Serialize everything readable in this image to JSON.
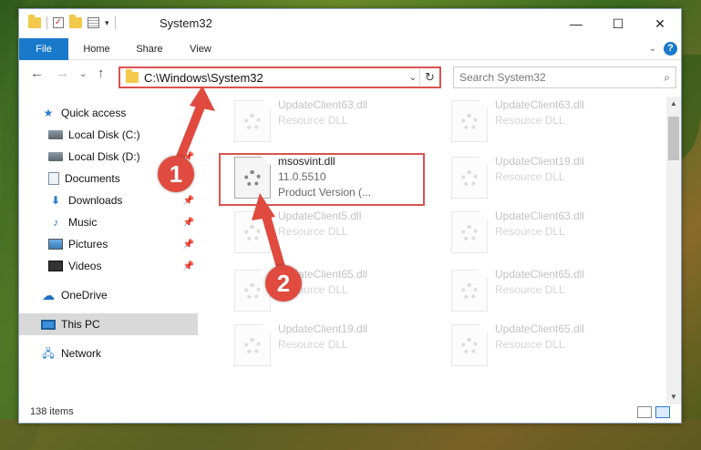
{
  "window": {
    "title": "System32",
    "minimize_icon": "minimize-icon",
    "maximize_icon": "maximize-icon",
    "close_icon": "close-icon"
  },
  "ribbon": {
    "tabs": [
      "File",
      "Home",
      "Share",
      "View"
    ],
    "accent": "#1979ca",
    "help": "?"
  },
  "nav": {
    "address": "C:\\Windows\\System32",
    "search_placeholder": "Search System32"
  },
  "sidebar": {
    "items": [
      {
        "label": "Quick access",
        "icon": "star-icon"
      },
      {
        "label": "Local Disk (C:)",
        "icon": "drive-icon"
      },
      {
        "label": "Local Disk (D:)",
        "icon": "drive-icon"
      },
      {
        "label": "Documents",
        "icon": "document-icon"
      },
      {
        "label": "Downloads",
        "icon": "download-icon"
      },
      {
        "label": "Music",
        "icon": "music-icon"
      },
      {
        "label": "Pictures",
        "icon": "pictures-icon"
      },
      {
        "label": "Videos",
        "icon": "videos-icon"
      },
      {
        "label": "OneDrive",
        "icon": "cloud-icon"
      },
      {
        "label": "This PC",
        "icon": "computer-icon"
      },
      {
        "label": "Network",
        "icon": "network-icon"
      }
    ]
  },
  "files": {
    "highlighted": {
      "name": "msosvint.dll",
      "version": "11.0.5510",
      "desc": "Product Version   (..."
    },
    "faded": [
      {
        "name": "UpdateClient63.dll",
        "desc": "Resource DLL"
      },
      {
        "name": "UpdateClient63.dll",
        "desc": "Resource DLL"
      },
      {
        "name": "UpdateClient19.dll",
        "desc": "Resource DLL"
      },
      {
        "name": "UpdateClient5.dll",
        "desc": "Resource DLL"
      },
      {
        "name": "UpdateClient63.dll",
        "desc": "Resource DLL"
      },
      {
        "name": "UpdateClient65.dll",
        "desc": "Resource DLL"
      },
      {
        "name": "UpdateClient65.dll",
        "desc": "Resource DLL"
      },
      {
        "name": "UpdateClient19.dll",
        "desc": "Resource DLL"
      },
      {
        "name": "UpdateClient65.dll",
        "desc": "Resource DLL"
      }
    ]
  },
  "status": {
    "count": "138 items"
  },
  "markers": [
    "1",
    "2"
  ],
  "highlight_color": "#d9534f"
}
